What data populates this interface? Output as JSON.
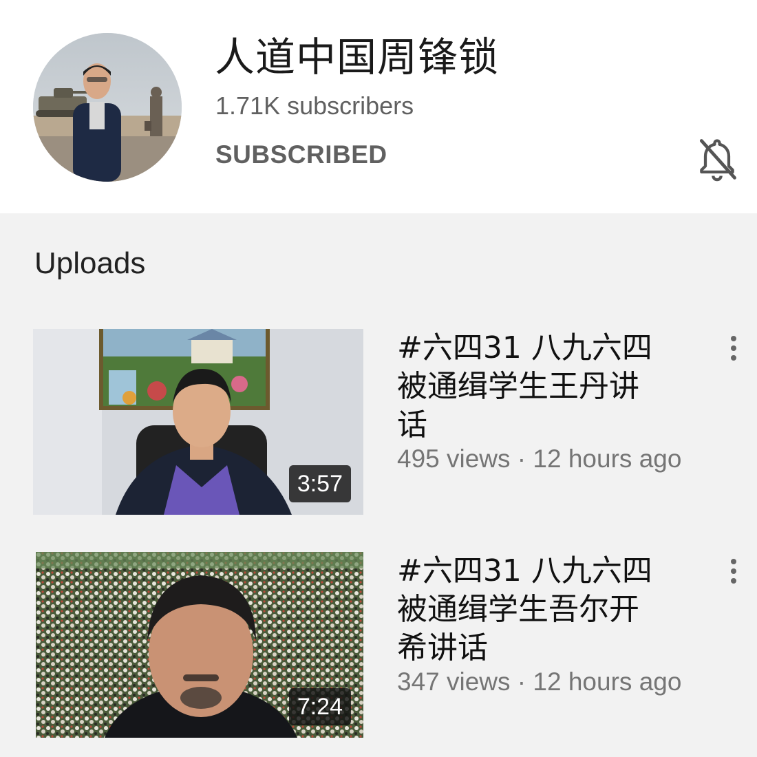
{
  "channel": {
    "name": "人道中国周锋锁",
    "subscribers": "1.71K subscribers",
    "subscribe_state": "SUBSCRIBED",
    "notifications_icon": "bell-off-icon"
  },
  "uploads": {
    "title": "Uploads",
    "videos": [
      {
        "title": "#六四31 八九六四\n被通缉学生王丹讲\n话",
        "views": "495 views",
        "age": "12 hours ago",
        "duration": "3:57"
      },
      {
        "title": "#六四31 八九六四\n被通缉学生吾尔开\n希讲话",
        "views": "347 views",
        "age": "12 hours ago",
        "duration": "7:24"
      }
    ]
  },
  "colors": {
    "header_bg": "#ffffff",
    "page_bg": "#f2f2f2",
    "secondary_text": "#606060",
    "duration_badge": "#141414"
  }
}
